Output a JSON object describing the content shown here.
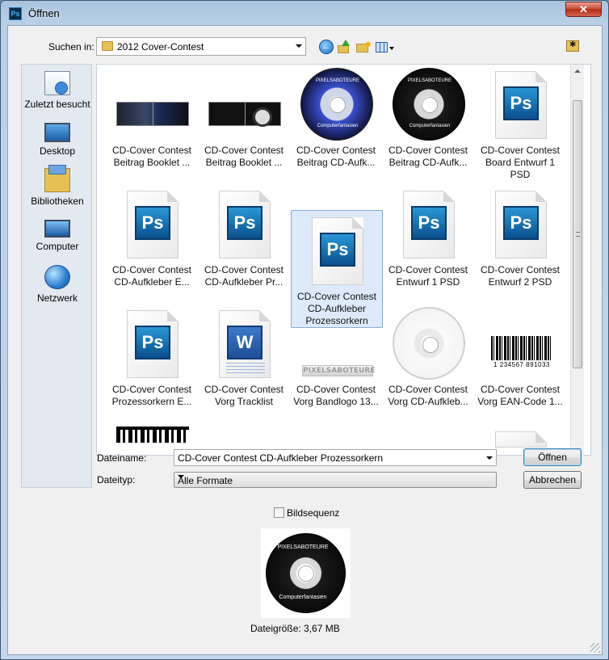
{
  "window": {
    "title": "Öffnen",
    "app_icon_text": "Ps",
    "close_glyph": "✕"
  },
  "toolbar": {
    "lookin_label": "Suchen in:",
    "lookin_value": "2012 Cover-Contest",
    "icons": [
      "back-icon",
      "up-folder-icon",
      "new-folder-icon",
      "view-menu-icon",
      "favorites-folder-icon"
    ]
  },
  "places": [
    {
      "label": "Zuletzt besucht",
      "icon": "recent-places-icon"
    },
    {
      "label": "Desktop",
      "icon": "desktop-icon"
    },
    {
      "label": "Bibliotheken",
      "icon": "libraries-icon"
    },
    {
      "label": "Computer",
      "icon": "computer-icon"
    },
    {
      "label": "Netzwerk",
      "icon": "network-icon"
    }
  ],
  "files": [
    {
      "line1": "CD-Cover Contest",
      "line2": "Beitrag Booklet ...",
      "kind": "booklet"
    },
    {
      "line1": "CD-Cover Contest",
      "line2": "Beitrag Booklet ...",
      "kind": "booklet2"
    },
    {
      "line1": "CD-Cover Contest",
      "line2": "Beitrag CD-Aufk...",
      "kind": "disc-color",
      "thumb_text_top": "PIXELSABOTEURE",
      "thumb_text_bottom": "Computerfantasien"
    },
    {
      "line1": "CD-Cover Contest",
      "line2": "Beitrag CD-Aufk...",
      "kind": "disc-dark",
      "thumb_text_top": "PIXELSABOTEURE",
      "thumb_text_bottom": "Computerfantasien"
    },
    {
      "line1": "CD-Cover Contest",
      "line2": "Board Entwurf 1 PSD",
      "kind": "psd",
      "thumb_text": "Ps"
    },
    {
      "line1": "CD-Cover Contest",
      "line2": "CD-Aufkleber E...",
      "kind": "psd",
      "thumb_text": "Ps"
    },
    {
      "line1": "CD-Cover Contest",
      "line2": "CD-Aufkleber Pr...",
      "kind": "psd",
      "thumb_text": "Ps"
    },
    {
      "line1": "CD-Cover Contest",
      "line2": "CD-Aufkleber",
      "line3": "Prozessorkern",
      "kind": "psd",
      "selected": true,
      "thumb_text": "Ps"
    },
    {
      "line1": "CD-Cover Contest",
      "line2": "Entwurf 1 PSD",
      "kind": "psd",
      "thumb_text": "Ps"
    },
    {
      "line1": "CD-Cover Contest",
      "line2": "Entwurf 2 PSD",
      "kind": "psd",
      "thumb_text": "Ps"
    },
    {
      "line1": "CD-Cover Contest",
      "line2": "Prozessorkern E...",
      "kind": "psd",
      "thumb_text": "Ps"
    },
    {
      "line1": "CD-Cover Contest",
      "line2": "Vorg  Tracklist",
      "kind": "word",
      "thumb_text": "W"
    },
    {
      "line1": "CD-Cover Contest",
      "line2": "Vorg Bandlogo 13...",
      "kind": "bandlogo",
      "thumb_text": "PIXELSABOTEURE"
    },
    {
      "line1": "CD-Cover Contest",
      "line2": "Vorg CD-Aufkleb...",
      "kind": "disc-blank"
    },
    {
      "line1": "CD-Cover Contest",
      "line2": "Vorg EAN-Code 1...",
      "kind": "barcode",
      "thumb_text": "1 234567 891033"
    },
    {
      "kind": "qr"
    },
    {
      "kind": "psd-partial"
    }
  ],
  "form": {
    "filename_label": "Dateiname:",
    "filename_value": "CD-Cover Contest CD-Aufkleber Prozessorkern",
    "filetype_label": "Dateityp:",
    "filetype_value": "Alle Formate",
    "open_button": "Öffnen",
    "cancel_button": "Abbrechen",
    "sequence_label": "Bildsequenz",
    "sequence_checked": false
  },
  "preview": {
    "top_text": "PIXELSABOTEURE",
    "bottom_text": "Computerfantasien",
    "file_size": "Dateigröße: 3,67 MB"
  },
  "colors": {
    "selection_bg": "#dceafc",
    "selection_border": "#84acdd",
    "ps_blue": "#2a97d6"
  }
}
